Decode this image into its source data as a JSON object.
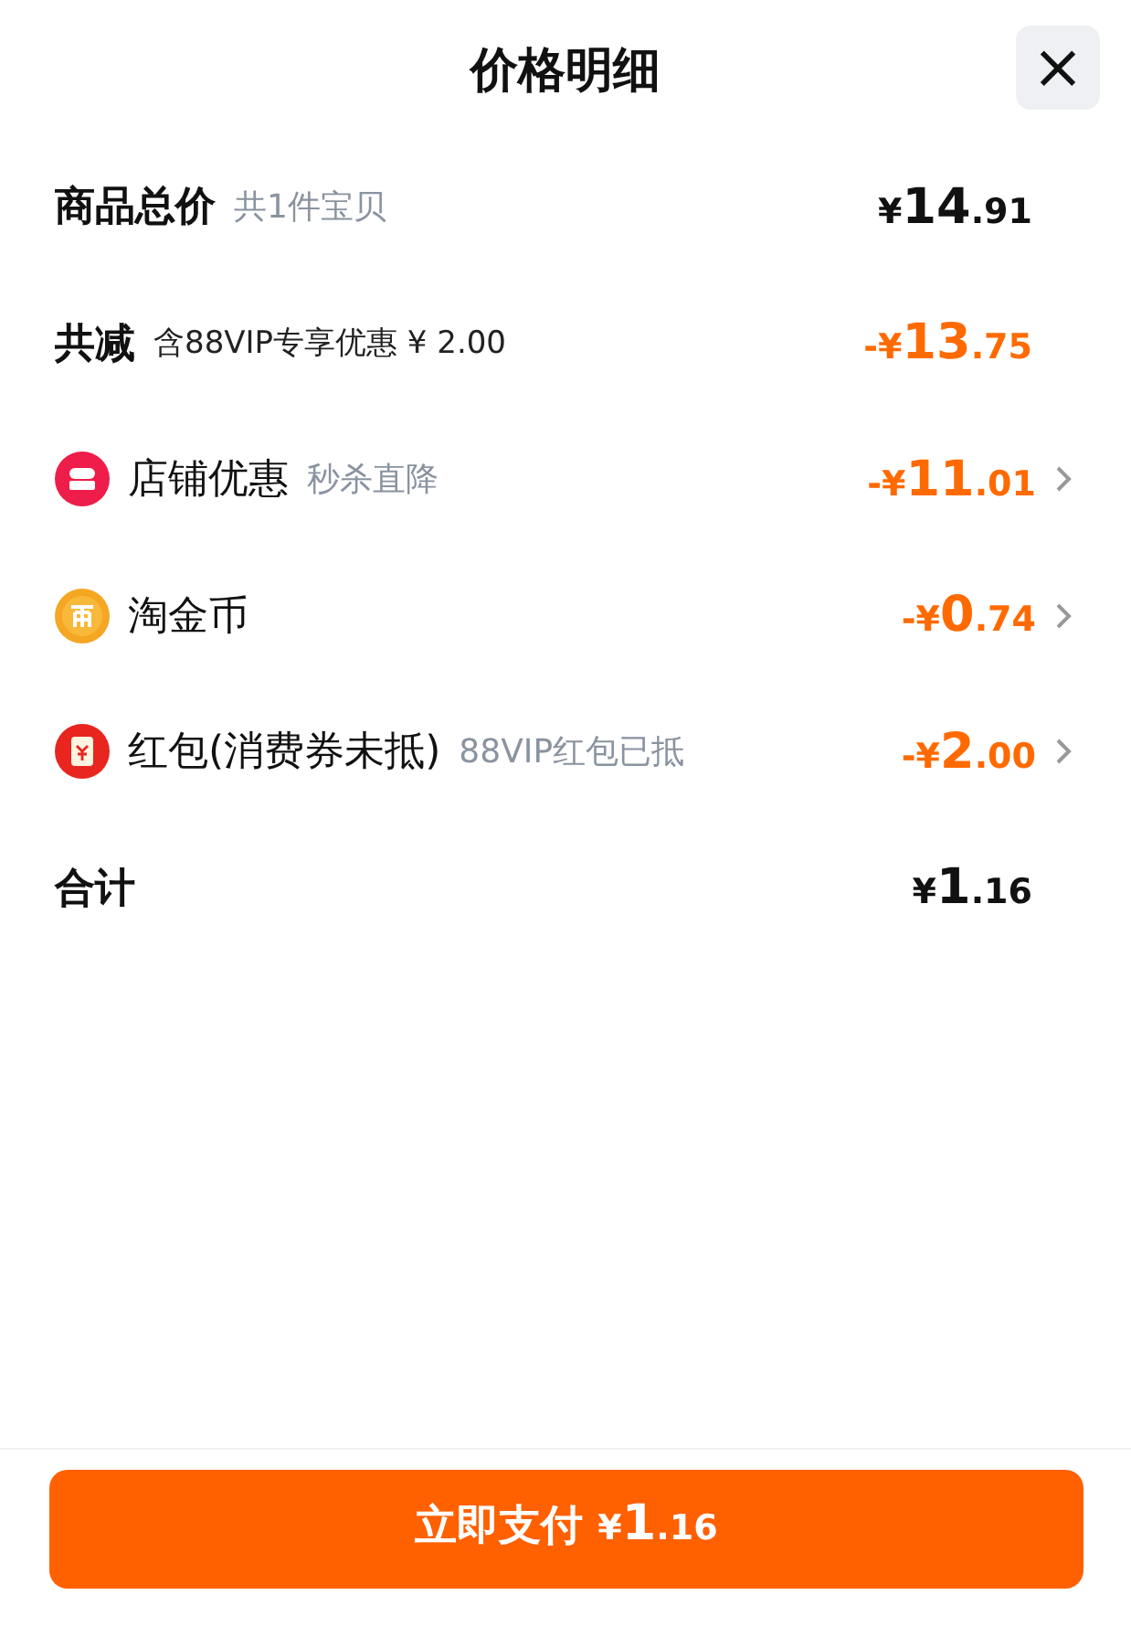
{
  "header": {
    "title": "价格明细",
    "close": "×"
  },
  "rows": [
    {
      "kind": "subtotal",
      "label": "商品总价",
      "note": "共1件宝贝",
      "amount": "¥14.91",
      "negative": false
    },
    {
      "kind": "discount_total",
      "label": "共减",
      "note": "含88VIP专享优惠 ¥ 2.00",
      "amount": "-¥13.75",
      "negative": true
    },
    {
      "kind": "shop",
      "label": "店铺优惠",
      "note": "秒杀直降",
      "amount": "-¥11.01",
      "negative": true
    },
    {
      "kind": "coin",
      "label": "淘金币",
      "amount": "-¥0.74",
      "negative": true
    },
    {
      "kind": "packet",
      "label": "红包(消费券未抵)",
      "note": "88VIP红包已抵",
      "amount": "-¥2.00",
      "negative": true
    },
    {
      "kind": "total",
      "label": "合计",
      "amount": "¥1.16",
      "negative": false
    }
  ],
  "pay_button": {
    "label": "立即支付",
    "amount": "¥1.16"
  }
}
